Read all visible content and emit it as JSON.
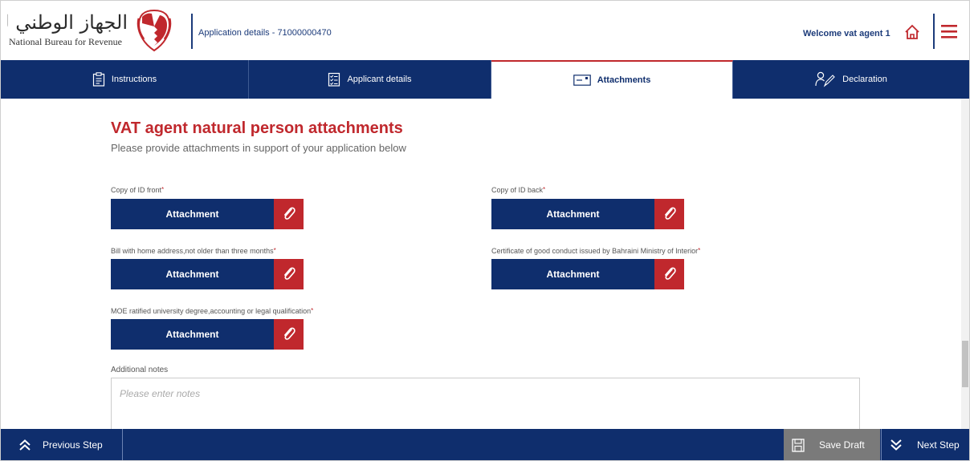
{
  "header": {
    "logo_arabic": "الجهاز الوطني للإيرادات",
    "logo_english": "National Bureau for Revenue",
    "app_title": "Application details - 71000000470",
    "welcome": "Welcome vat agent 1",
    "home_icon": "home-icon",
    "menu_icon": "hamburger-menu-icon",
    "accent_color": "#c0282d",
    "brand_color": "#0f2e6d"
  },
  "tabs": [
    {
      "label": "Instructions",
      "icon": "clipboard-icon",
      "active": false
    },
    {
      "label": "Applicant details",
      "icon": "checklist-icon",
      "active": false
    },
    {
      "label": "Attachments",
      "icon": "attachment-card-icon",
      "active": true
    },
    {
      "label": "Declaration",
      "icon": "person-pen-icon",
      "active": false
    }
  ],
  "main": {
    "title": "VAT agent natural person attachments",
    "subtitle": "Please provide attachments in support of your application below",
    "required_mark": "*",
    "attachment_button_label": "Attachment",
    "fields": [
      {
        "label": "Copy of ID front"
      },
      {
        "label": "Copy of ID back"
      },
      {
        "label": "Bill with home address,not older than three months"
      },
      {
        "label": "Certificate of good conduct issued by Bahraini Ministry of Interior"
      },
      {
        "label": "MOE ratified university degree,accounting or legal qualification"
      }
    ],
    "notes_label": "Additional notes",
    "notes_placeholder": "Please enter notes",
    "notes_value": ""
  },
  "footer": {
    "previous_label": "Previous Step",
    "save_draft_label": "Save Draft",
    "next_label": "Next Step"
  }
}
